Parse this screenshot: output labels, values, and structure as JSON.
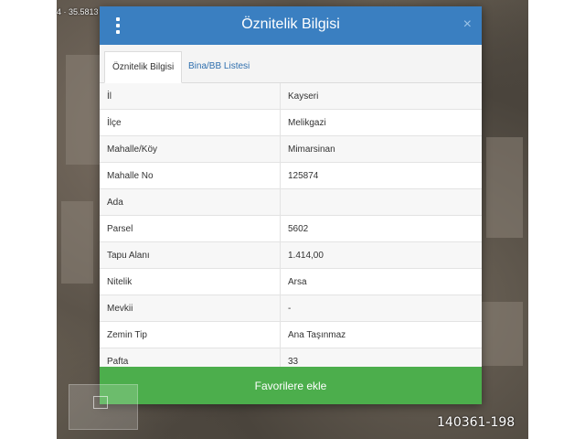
{
  "map": {
    "coordinate_text": "4 · 35.5813"
  },
  "dialog": {
    "title": "Öznitelik Bilgisi",
    "close_symbol": "×",
    "tabs": [
      {
        "label": "Öznitelik Bilgisi",
        "active": true
      },
      {
        "label": "Bina/BB Listesi",
        "active": false
      }
    ],
    "rows": [
      {
        "key": "İl",
        "value": "Kayseri"
      },
      {
        "key": "İlçe",
        "value": "Melikgazi"
      },
      {
        "key": "Mahalle/Köy",
        "value": "Mimarsinan"
      },
      {
        "key": "Mahalle No",
        "value": "125874"
      },
      {
        "key": "Ada",
        "value": ""
      },
      {
        "key": "Parsel",
        "value": "5602"
      },
      {
        "key": "Tapu Alanı",
        "value": "1.414,00"
      },
      {
        "key": "Nitelik",
        "value": "Arsa"
      },
      {
        "key": "Mevkii",
        "value": "-"
      },
      {
        "key": "Zemin Tip",
        "value": "Ana Taşınmaz"
      },
      {
        "key": "Pafta",
        "value": "33"
      }
    ],
    "favorite_button_label": "Favorilere ekle"
  },
  "listing_reference": "140361-198",
  "colors": {
    "header": "#3a7fc1",
    "button": "#4cae4c",
    "tab_link": "#2f6fae"
  }
}
